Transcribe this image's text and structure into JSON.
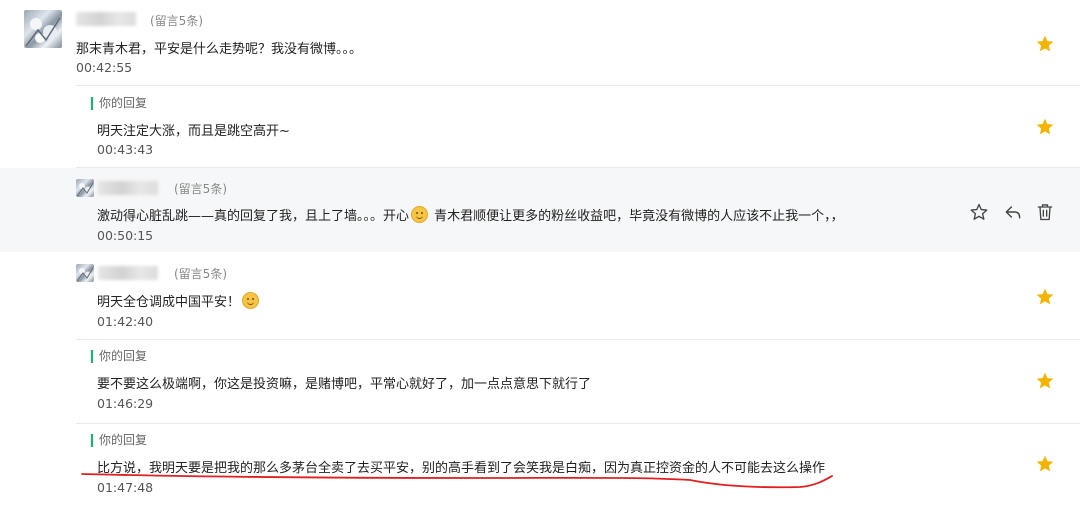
{
  "colors": {
    "star": "#f4b400",
    "reply_bar": "#07c160",
    "hover_bg": "#f6f7f8",
    "underline": "#e02020"
  },
  "messages": [
    {
      "count": "(留言5条)",
      "text": "那末青木君，平安是什么走势呢？我没有微博。。。",
      "time": "00:42:55"
    },
    {
      "reply_label": "你的回复",
      "text": "明天注定大涨，而且是跳空高开~",
      "time": "00:43:43"
    },
    {
      "count": "(留言5条)",
      "text_a": "激动得心脏乱跳——真的回复了我，且上了墙。。。开心",
      "text_b": " 青木君顺便让更多的粉丝收益吧，毕竟没有微博的人应该不止我一个，，",
      "time": "00:50:15"
    },
    {
      "count": "(留言5条)",
      "text": "明天全仓调成中国平安！",
      "time": "01:42:40"
    },
    {
      "reply_label": "你的回复",
      "text": "要不要这么极端啊，你这是投资嘛，是赌博吧，平常心就好了，加一点点意思下就行了",
      "time": "01:46:29"
    },
    {
      "reply_label": "你的回复",
      "text": "比方说，我明天要是把我的那么多茅台全卖了去买平安，别的高手看到了会笑我是白痴，因为真正控资金的人不可能去这么操作",
      "time": "01:47:48"
    }
  ],
  "actions": [
    "star-outline-icon",
    "reply-icon",
    "trash-icon"
  ]
}
